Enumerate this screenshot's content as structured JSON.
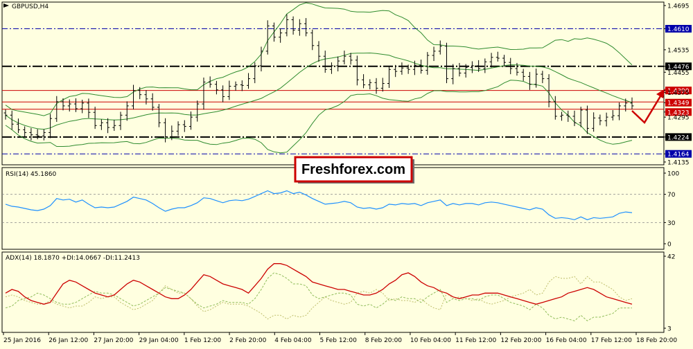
{
  "colors": {
    "bg": "#ffffe0",
    "bullbear": "#000000",
    "bands": "#2e8b2e",
    "rsi": "#1e90ff",
    "adx": "#cc0000",
    "diplus": "#8fbc5a",
    "diminus": "#bdbd6a",
    "hlevel": "#000000",
    "redlevel": "#cc0000",
    "arrow": "#cc0000",
    "bluelevel": "#0000aa"
  },
  "chart_data": {
    "type": "candlestick",
    "symbol_label": "GBPUSD,H4",
    "watermark": "Freshforex.com",
    "price_ylim": [
      1.4125,
      1.4705
    ],
    "price_ticks": [
      "1.4695",
      "1.4610",
      "1.4535",
      "1.4476",
      "1.4455",
      "1.4390",
      "1.4375",
      "1.4349",
      "1.4323",
      "1.4295",
      "1.4224",
      "1.4164",
      "1.4135"
    ],
    "highlighted_levels": [
      {
        "value": "1.4610",
        "style": "blue-dashdot"
      },
      {
        "value": "1.4476",
        "style": "black-thick"
      },
      {
        "value": "1.4390",
        "style": "red"
      },
      {
        "value": "1.4349",
        "style": "red"
      },
      {
        "value": "1.4323",
        "style": "red"
      },
      {
        "value": "1.4224",
        "style": "black-thick"
      },
      {
        "value": "1.4164",
        "style": "blue-dashdot"
      }
    ],
    "x_labels": [
      "25 Jan 2016",
      "26 Jan 12:00",
      "27 Jan 20:00",
      "29 Jan 04:00",
      "1 Feb 12:00",
      "2 Feb 20:00",
      "4 Feb 04:00",
      "5 Feb 12:00",
      "8 Feb 20:00",
      "10 Feb 04:00",
      "11 Feb 12:00",
      "12 Feb 20:00",
      "16 Feb 04:00",
      "17 Feb 12:00",
      "18 Feb 20:00"
    ],
    "close": [
      1.4302,
      1.427,
      1.425,
      1.424,
      1.4232,
      1.4228,
      1.424,
      1.429,
      1.435,
      1.4335,
      1.4342,
      1.4325,
      1.4345,
      1.4312,
      1.4265,
      1.4275,
      1.4258,
      1.4265,
      1.4302,
      1.4335,
      1.439,
      1.4375,
      1.436,
      1.433,
      1.4275,
      1.4225,
      1.4245,
      1.4268,
      1.4262,
      1.4295,
      1.4342,
      1.442,
      1.4412,
      1.4392,
      1.4368,
      1.4405,
      1.441,
      1.4408,
      1.4432,
      1.4478,
      1.453,
      1.462,
      1.458,
      1.4595,
      1.4642,
      1.4605,
      1.4628,
      1.4595,
      1.455,
      1.4512,
      1.4465,
      1.4478,
      1.4495,
      1.4512,
      1.4498,
      1.4428,
      1.441,
      1.4418,
      1.4398,
      1.4415,
      1.4465,
      1.4458,
      1.447,
      1.4465,
      1.448,
      1.4462,
      1.4515,
      1.453,
      1.4548,
      1.4432,
      1.4468,
      1.4452,
      1.4472,
      1.4478,
      1.4468,
      1.4492,
      1.4508,
      1.4505,
      1.449,
      1.4468,
      1.4455,
      1.444,
      1.4412,
      1.4448,
      1.4432,
      1.435,
      1.4298,
      1.4302,
      1.4298,
      1.4275,
      1.432,
      1.4255,
      1.4292,
      1.4282,
      1.4295,
      1.43,
      1.4335,
      1.4345,
      1.4335
    ],
    "rsi_ylim": [
      0,
      100
    ],
    "rsi_ticks": [
      100,
      70,
      30,
      0
    ],
    "rsi_label": "RSI(14) 45.1860",
    "rsi": [
      56,
      53,
      52,
      50,
      48,
      47,
      49,
      54,
      64,
      62,
      63,
      59,
      62,
      56,
      51,
      52,
      51,
      52,
      56,
      60,
      66,
      64,
      62,
      57,
      51,
      46,
      49,
      51,
      51,
      54,
      58,
      65,
      64,
      61,
      58,
      61,
      62,
      61,
      63,
      67,
      71,
      75,
      71,
      72,
      75,
      71,
      73,
      69,
      64,
      60,
      56,
      57,
      58,
      60,
      58,
      52,
      50,
      51,
      49,
      51,
      56,
      55,
      57,
      56,
      57,
      54,
      58,
      60,
      62,
      54,
      57,
      55,
      57,
      57,
      55,
      58,
      59,
      58,
      56,
      54,
      52,
      50,
      48,
      51,
      49,
      41,
      36,
      37,
      36,
      34,
      38,
      34,
      37,
      36,
      37,
      38,
      43,
      45,
      44
    ],
    "adx_ylim": [
      3,
      42
    ],
    "adx_ticks": [
      42,
      3
    ],
    "adx_label": "ADX(14) 18.1870 +DI:14.0667 -DI:11.2413",
    "adx": [
      22,
      24,
      23,
      20,
      18,
      17,
      16,
      17,
      22,
      27,
      29,
      28,
      26,
      24,
      22,
      21,
      20,
      21,
      24,
      27,
      29,
      28,
      26,
      24,
      22,
      20,
      19,
      19,
      21,
      24,
      28,
      32,
      31,
      29,
      27,
      26,
      25,
      24,
      22,
      26,
      30,
      35,
      38,
      38,
      37,
      35,
      33,
      31,
      28,
      27,
      26,
      25,
      24,
      24,
      23,
      22,
      21,
      21,
      22,
      24,
      27,
      29,
      32,
      33,
      31,
      28,
      26,
      25,
      23,
      22,
      20,
      19,
      20,
      21,
      21,
      22,
      22,
      22,
      21,
      20,
      19,
      18,
      17,
      16,
      17,
      18,
      19,
      20,
      22,
      23,
      24,
      25,
      24,
      22,
      20,
      19,
      18,
      17,
      16
    ],
    "diplus": [
      14,
      15,
      18,
      19,
      20,
      22,
      21,
      19,
      17,
      16,
      16,
      17,
      19,
      21,
      23,
      22,
      22,
      21,
      19,
      17,
      15,
      16,
      18,
      20,
      22,
      25,
      24,
      23,
      22,
      19,
      16,
      14,
      15,
      16,
      18,
      17,
      17,
      17,
      16,
      19,
      24,
      30,
      33,
      32,
      30,
      27,
      27,
      26,
      21,
      19,
      20,
      21,
      22,
      22,
      21,
      16,
      15,
      16,
      14,
      16,
      19,
      18,
      20,
      19,
      19,
      17,
      20,
      22,
      24,
      17,
      19,
      18,
      19,
      19,
      18,
      20,
      21,
      21,
      19,
      17,
      16,
      15,
      13,
      16,
      14,
      10,
      8,
      9,
      8,
      7,
      10,
      7,
      9,
      9,
      10,
      11,
      14,
      14,
      14
    ],
    "diminus": [
      20,
      21,
      20,
      18,
      17,
      16,
      16,
      18,
      16,
      15,
      14,
      15,
      15,
      17,
      20,
      19,
      20,
      20,
      17,
      15,
      13,
      14,
      16,
      18,
      22,
      26,
      24,
      22,
      22,
      19,
      15,
      12,
      13,
      15,
      17,
      16,
      16,
      16,
      15,
      13,
      11,
      8,
      10,
      10,
      8,
      10,
      9,
      10,
      14,
      17,
      20,
      18,
      17,
      16,
      17,
      22,
      23,
      22,
      24,
      22,
      18,
      19,
      18,
      18,
      17,
      19,
      16,
      14,
      13,
      22,
      19,
      20,
      19,
      18,
      19,
      17,
      16,
      17,
      18,
      20,
      21,
      22,
      24,
      21,
      22,
      28,
      31,
      30,
      30,
      31,
      27,
      31,
      28,
      28,
      26,
      24,
      20,
      18,
      19
    ]
  }
}
